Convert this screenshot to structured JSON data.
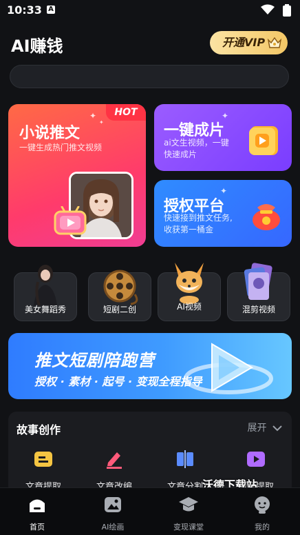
{
  "status": {
    "time": "10:33"
  },
  "header": {
    "title": "AI赚钱",
    "vip_label": "开通VIP"
  },
  "search": {
    "placeholder": ""
  },
  "cards": {
    "novel": {
      "title": "小说推文",
      "subtitle": "一键生成热门推文视频",
      "badge": "HOT"
    },
    "oneclick": {
      "title": "一键成片",
      "subtitle_line1": "ai文生视频，一键",
      "subtitle_line2": "快速成片"
    },
    "auth": {
      "title": "授权平台",
      "subtitle_line1": "快速接到推文任务,",
      "subtitle_line2": "收获第一桶金"
    }
  },
  "tiles": [
    {
      "label": "美女舞蹈秀"
    },
    {
      "label": "短剧二创"
    },
    {
      "label": "AI视频"
    },
    {
      "label": "混剪视频"
    }
  ],
  "banner": {
    "title": "推文短剧陪跑营",
    "subtitle": "授权 · 素材 · 起号 · 变现全程指导"
  },
  "story": {
    "title": "故事创作",
    "expand_label": "展开",
    "tools": [
      {
        "label": "文章提取",
        "color": "#f5c542"
      },
      {
        "label": "文章改编",
        "color": "#ff5a7a"
      },
      {
        "label": "文章分割",
        "color": "#5b8cff"
      },
      {
        "label": "视频提取",
        "color": "#b06bff"
      }
    ]
  },
  "watermark": "沃德下载站",
  "tabs": [
    {
      "label": "首页",
      "active": true
    },
    {
      "label": "AI绘画",
      "active": false
    },
    {
      "label": "变现课堂",
      "active": false
    },
    {
      "label": "我的",
      "active": false
    }
  ]
}
